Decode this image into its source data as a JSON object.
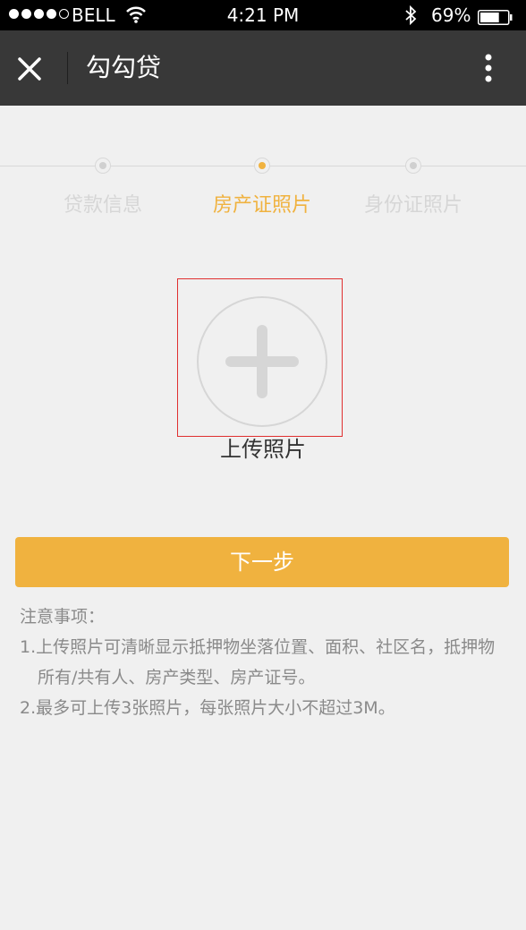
{
  "status_bar": {
    "carrier": "BELL",
    "time": "4:21 PM",
    "battery": "69%",
    "battery_level": 0.69
  },
  "header": {
    "title": "勾勾贷"
  },
  "steps": [
    {
      "label": "贷款信息",
      "active": false
    },
    {
      "label": "房产证照片",
      "active": true
    },
    {
      "label": "身份证照片",
      "active": false
    }
  ],
  "upload": {
    "label": "上传照片"
  },
  "next_button": {
    "label": "下一步"
  },
  "notes": {
    "title": "注意事项：",
    "items": [
      "1.上传照片可清晰显示抵押物坐落位置、面积、社区名，抵押物所有/共有人、房产类型、房产证号。",
      "2.最多可上传3张照片，每张照片大小不超过3M。"
    ]
  },
  "colors": {
    "accent": "#f0b23f",
    "header_bg": "#383838",
    "page_bg": "#f0f0f0"
  }
}
